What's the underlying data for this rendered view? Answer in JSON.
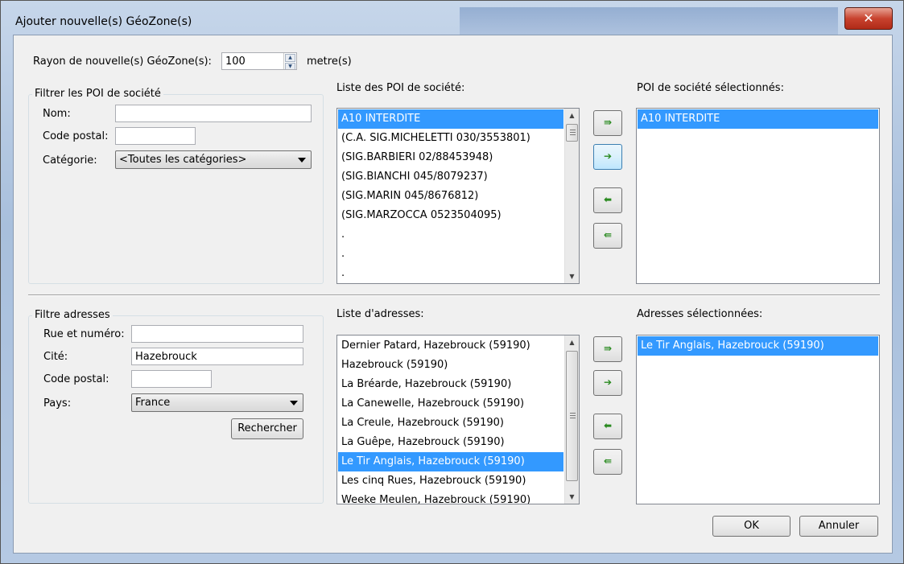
{
  "window": {
    "title": "Ajouter nouvelle(s) GéoZone(s)",
    "close_label": "✕"
  },
  "radius": {
    "label": "Rayon de nouvelle(s) GéoZone(s):",
    "value": "100",
    "unit": "metre(s)"
  },
  "poi_filter": {
    "title": "Filtrer les POI de société",
    "name_label": "Nom:",
    "name_value": "",
    "postal_label": "Code postal:",
    "postal_value": "",
    "category_label": "Catégorie:",
    "category_value": "<Toutes les catégories>"
  },
  "poi_list": {
    "label": "Liste des POI de société:",
    "items": [
      "A10 INTERDITE",
      "(C.A. SIG.MICHELETTI 030/3553801)",
      "(SIG.BARBIERI 02/88453948)",
      "(SIG.BIANCHI 045/8079237)",
      "(SIG.MARIN 045/8676812)",
      "(SIG.MARZOCCA 0523504095)",
      ".",
      ".",
      "."
    ],
    "selected": "A10 INTERDITE"
  },
  "poi_selected": {
    "label": "POI de société sélectionnés:",
    "items": [
      "A10 INTERDITE"
    ]
  },
  "address_filter": {
    "title": "Filtre adresses",
    "street_label": "Rue et numéro:",
    "street_value": "",
    "city_label": "Cité:",
    "city_value": "Hazebrouck",
    "postal_label": "Code postal:",
    "postal_value": "",
    "country_label": "Pays:",
    "country_value": "France",
    "search_label": "Rechercher"
  },
  "address_list": {
    "label": "Liste d'adresses:",
    "items": [
      "Dernier Patard, Hazebrouck (59190)",
      "Hazebrouck (59190)",
      "La Bréarde, Hazebrouck (59190)",
      "La Canewelle, Hazebrouck (59190)",
      "La Creule, Hazebrouck (59190)",
      "La Guêpe, Hazebrouck (59190)",
      "Le Tir Anglais, Hazebrouck (59190)",
      "Les cinq Rues, Hazebrouck (59190)",
      "Weeke Meulen, Hazebrouck (59190)"
    ],
    "selected": "Le Tir Anglais, Hazebrouck (59190)"
  },
  "address_selected": {
    "label": "Adresses sélectionnées:",
    "items": [
      "Le Tir Anglais, Hazebrouck (59190)"
    ]
  },
  "move_buttons": {
    "add_all": "⇛",
    "add": "➔",
    "remove": "⬅",
    "remove_all": "⇚"
  },
  "footer": {
    "ok_label": "OK",
    "cancel_label": "Annuler"
  },
  "colors": {
    "selection": "#3399ff",
    "arrow_icon": "#2a8a20",
    "close_button": "#c8432f"
  }
}
